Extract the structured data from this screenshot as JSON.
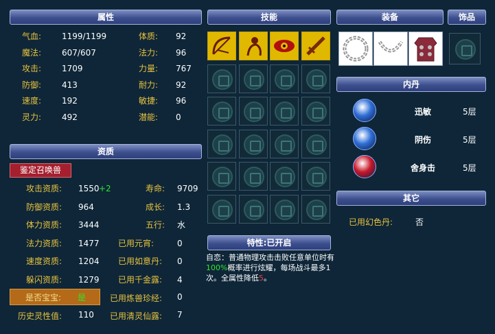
{
  "headers": {
    "attributes": "属性",
    "skills": "技能",
    "equipment": "装备",
    "accessory": "饰品",
    "aptitude": "资质",
    "inner_dan": "内丹",
    "other": "其它",
    "trait": "特性:已开启"
  },
  "attributes": [
    {
      "label": "气血:",
      "value": "1199/1199",
      "label2": "体质:",
      "value2": "92"
    },
    {
      "label": "魔法:",
      "value": "607/607",
      "label2": "法力:",
      "value2": "96"
    },
    {
      "label": "攻击:",
      "value": "1709",
      "label2": "力量:",
      "value2": "767"
    },
    {
      "label": "防御:",
      "value": "413",
      "label2": "耐力:",
      "value2": "92"
    },
    {
      "label": "速度:",
      "value": "192",
      "label2": "敏捷:",
      "value2": "96"
    },
    {
      "label": "灵力:",
      "value": "492",
      "label2": "潜能:",
      "value2": "0"
    }
  ],
  "identify_button": "鉴定召唤兽",
  "aptitude": {
    "rows": [
      {
        "label": "攻击资质:",
        "value": "1550",
        "bonus": "+2",
        "label2": "寿命:",
        "value2": "9709"
      },
      {
        "label": "防御资质:",
        "value": "964",
        "bonus": "",
        "label2": "成长:",
        "value2": "1.3"
      },
      {
        "label": "体力资质:",
        "value": "3444",
        "bonus": "",
        "label2": "五行:",
        "value2": "水"
      },
      {
        "label": "法力资质:",
        "value": "1477",
        "bonus": "",
        "label2": "已用元宵:",
        "value2": "0"
      },
      {
        "label": "速度资质:",
        "value": "1204",
        "bonus": "",
        "label2": "已用如意丹:",
        "value2": "0"
      },
      {
        "label": "躲闪资质:",
        "value": "1279",
        "bonus": "",
        "label2": "已用千金露:",
        "value2": "4"
      }
    ],
    "baby_label": "是否宝宝:",
    "baby_value": "是",
    "lianshou_label": "已用炼兽珍经:",
    "lianshou_value": "0",
    "history_label": "历史灵性值:",
    "history_value": "110",
    "qingling_label": "已用清灵仙露:",
    "qingling_value": "7"
  },
  "skills": [
    {
      "icon": "bow-icon",
      "color": "#e0b800"
    },
    {
      "icon": "spirit-figure-icon",
      "color": "#e0b800"
    },
    {
      "icon": "eye-icon",
      "color": "#e0b800"
    },
    {
      "icon": "sword-icon",
      "color": "#e0b800"
    }
  ],
  "inner_dan": [
    {
      "name": "迅敏",
      "level": "5层",
      "color": "#2f6fd8",
      "icon": "claw-icon"
    },
    {
      "name": "阴伤",
      "level": "5层",
      "color": "#2f6fd8",
      "icon": "slash-icon"
    },
    {
      "name": "舍身击",
      "level": "5层",
      "color": "#c8182a",
      "icon": "fist-icon"
    }
  ],
  "other": {
    "label": "已用幻色丹:",
    "value": "否"
  },
  "trait_desc": {
    "p1": "自恋：普通物理攻击击败任意单位时有",
    "pct": "100%",
    "p2": "概率进行炫耀，每场战斗最多1次。全属性降低",
    "num": "5",
    "p3": "。"
  }
}
